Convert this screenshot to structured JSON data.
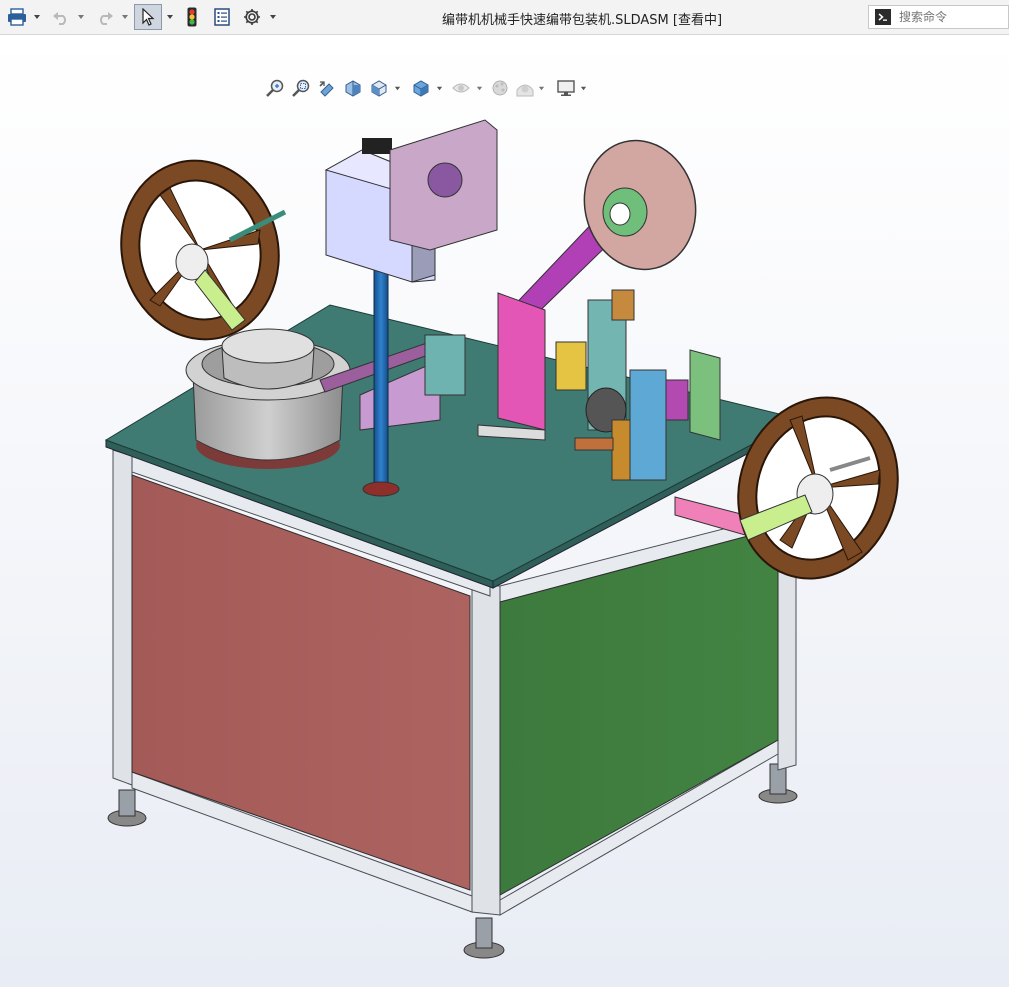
{
  "window": {
    "title": "编带机机械手快速编带包装机.SLDASM [查看中]"
  },
  "search": {
    "placeholder": "搜索命令"
  },
  "toolbar": {
    "items": [
      "print-icon",
      "undo-icon",
      "redo-icon",
      "select-icon",
      "rebuild-icon",
      "file-properties-icon",
      "options-icon"
    ]
  },
  "headsup_toolbar": {
    "items": [
      "zoom-to-fit-icon",
      "zoom-to-area-icon",
      "previous-view-icon",
      "section-view-icon",
      "view-orientation-icon",
      "display-style-icon",
      "hide-show-items-icon",
      "edit-appearance-icon",
      "apply-scene-icon",
      "view-settings-icon"
    ]
  },
  "colors": {
    "table_top": "#3f7b73",
    "left_panel": "#a8605d",
    "right_panel": "#3f7a3f",
    "reel": "#7b4a24",
    "frame": "#d9dde3",
    "arm_magenta": "#b13fb5",
    "post_blue": "#1f68b3"
  }
}
